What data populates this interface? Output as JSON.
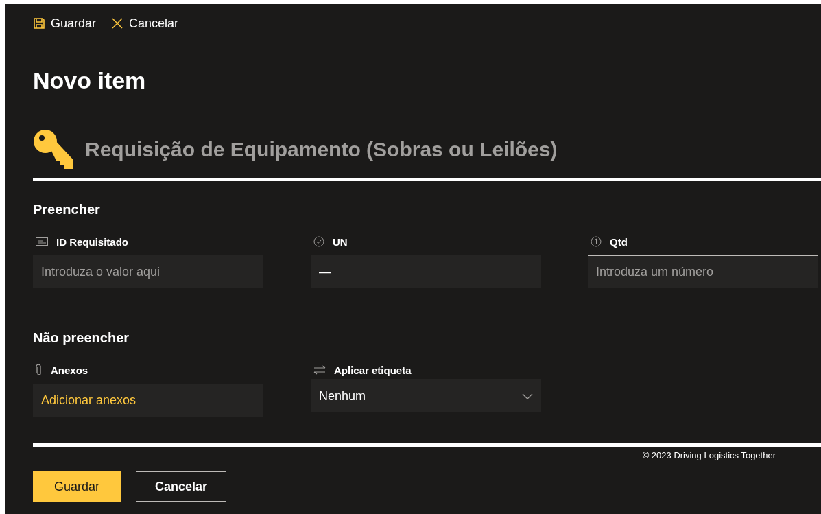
{
  "toolbar": [
    {
      "kind": "save",
      "label": "Guardar"
    },
    {
      "kind": "cancel",
      "label": "Cancelar"
    }
  ],
  "title": "Novo item",
  "form_header": "Requisição de Equipamento (Sobras ou Leilões)",
  "sections": [
    {
      "title": "Preencher",
      "fields": [
        {
          "kind": "text",
          "label": "ID Requisitado",
          "placeholder": "Introduza o valor aqui",
          "focused": false
        },
        {
          "kind": "choice",
          "label": "UN",
          "value": "—",
          "focused": false
        },
        {
          "kind": "number",
          "label": "Qtd",
          "placeholder": "Introduza um número",
          "focused": true
        }
      ]
    },
    {
      "title": "Não preencher",
      "fields": [
        {
          "kind": "attachments",
          "label": "Anexos",
          "value": "Adicionar anexos",
          "focused": false
        },
        {
          "kind": "tag",
          "label": "Aplicar etiqueta",
          "value": "Nenhum",
          "focused": false
        }
      ]
    }
  ],
  "footer": "© 2023 Driving Logistics Together",
  "buttons": [
    {
      "label": "Guardar",
      "primary": true
    },
    {
      "label": "Cancelar",
      "primary": false
    }
  ]
}
